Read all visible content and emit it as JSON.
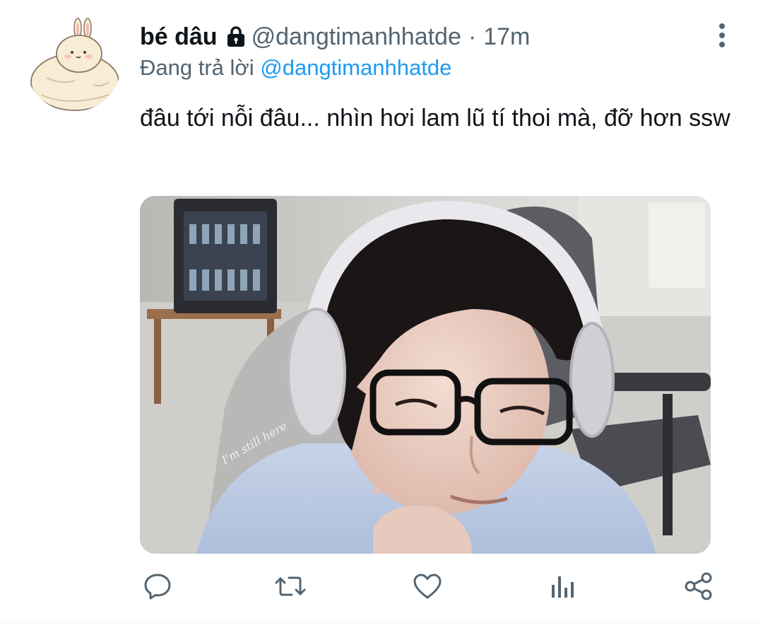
{
  "author": {
    "display_name": "bé dâu",
    "handle": "@dangtimanhhatde",
    "separator": "·",
    "time": "17m",
    "avatar_icon": "bunny-mochi-avatar",
    "protected_icon": "lock-icon"
  },
  "reply_context": {
    "prefix": "Đang trả lời",
    "mention": "@dangtimanhhatde"
  },
  "tweet": {
    "text": "đâu tới nỗi đâu... nhìn hơi lam lũ tí thoi mà, đỡ hơn ssw"
  },
  "media": {
    "description_icon": "photo-young-man-with-headphones-and-glasses",
    "watermark": "I'm still here"
  },
  "actions": [
    {
      "name": "reply",
      "icon": "speech-bubble-icon"
    },
    {
      "name": "retweet",
      "icon": "retweet-icon"
    },
    {
      "name": "like",
      "icon": "heart-icon"
    },
    {
      "name": "analytics",
      "icon": "bar-chart-icon"
    },
    {
      "name": "share",
      "icon": "share-icon"
    }
  ],
  "colors": {
    "text": "#0f1419",
    "secondary": "#536471",
    "link": "#1d9bf0"
  }
}
